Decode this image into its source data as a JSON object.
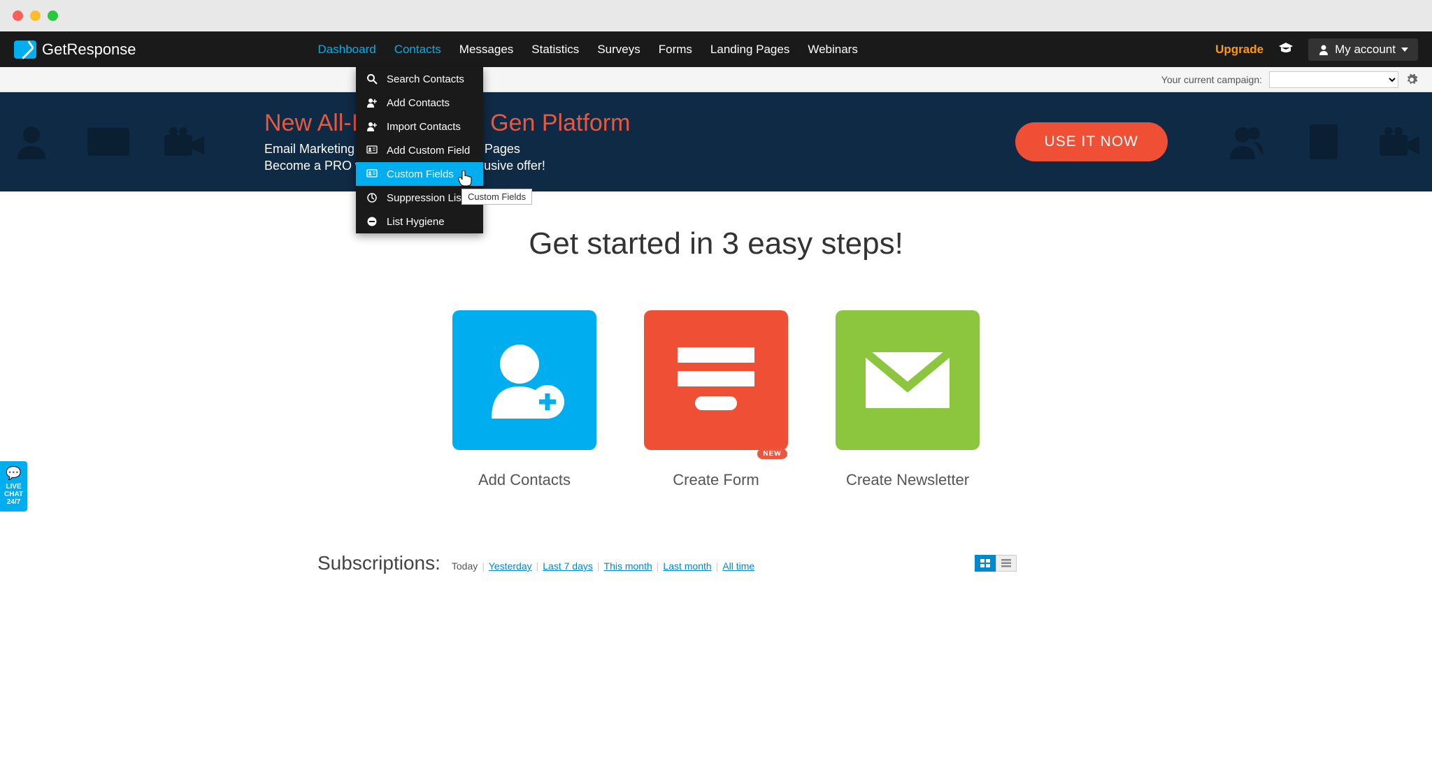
{
  "brand": "GetResponse",
  "nav": {
    "items": [
      "Dashboard",
      "Contacts",
      "Messages",
      "Statistics",
      "Surveys",
      "Forms",
      "Landing Pages",
      "Webinars"
    ],
    "active": [
      0,
      1
    ]
  },
  "nav_right": {
    "upgrade": "Upgrade",
    "account": "My account"
  },
  "campaign_bar": {
    "label": "Your current campaign:"
  },
  "hero": {
    "title": "New All-In-One Lead Gen Platform",
    "line1": "Email Marketing + Webinars + Landing Pages",
    "line2": "Become a PRO with GetResponse exclusive offer!",
    "button": "USE IT NOW"
  },
  "dropdown": {
    "items": [
      {
        "label": "Search Contacts",
        "icon": "search"
      },
      {
        "label": "Add Contacts",
        "icon": "person-plus"
      },
      {
        "label": "Import Contacts",
        "icon": "person-plus"
      },
      {
        "label": "Add Custom Field",
        "icon": "id-plus"
      },
      {
        "label": "Custom Fields",
        "icon": "id-card",
        "highlighted": true
      },
      {
        "label": "Suppression Lists",
        "icon": "circle-minus"
      },
      {
        "label": "List Hygiene",
        "icon": "minus"
      }
    ],
    "tooltip": "Custom Fields"
  },
  "main": {
    "heading": "Get started in 3 easy steps!",
    "steps": [
      {
        "label": "Add Contacts",
        "color": "blue"
      },
      {
        "label": "Create Form",
        "color": "red",
        "badge": "NEW"
      },
      {
        "label": "Create Newsletter",
        "color": "green"
      }
    ]
  },
  "live_chat": {
    "line1": "LIVE",
    "line2": "CHAT",
    "line3": "24/7"
  },
  "subscriptions": {
    "title": "Subscriptions:",
    "filters": [
      "Today",
      "Yesterday",
      "Last 7 days",
      "This month",
      "Last month",
      "All time"
    ],
    "current": "Today"
  }
}
